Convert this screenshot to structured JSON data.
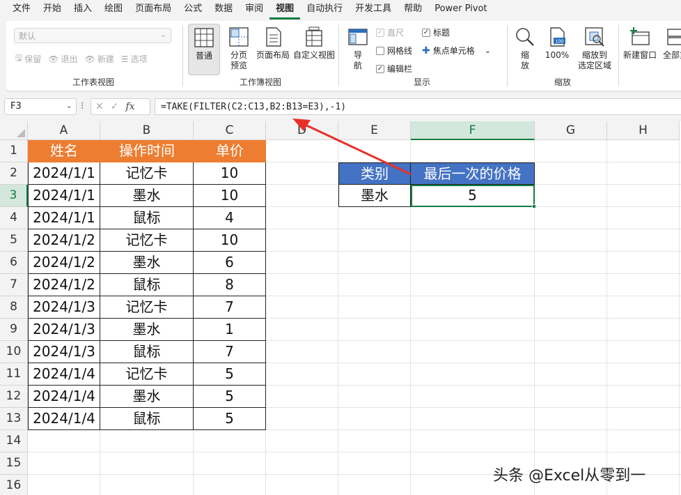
{
  "menu": {
    "tabs": [
      "文件",
      "开始",
      "插入",
      "绘图",
      "页面布局",
      "公式",
      "数据",
      "审阅",
      "视图",
      "自动执行",
      "开发工具",
      "帮助",
      "Power Pivot"
    ],
    "active_index": 8
  },
  "ribbon": {
    "sheet_view": {
      "dropdown_value": "默认",
      "keep": "保留",
      "exit": "退出",
      "new": "新建",
      "options": "选项",
      "group_label": "工作表视图"
    },
    "workbook_views": {
      "normal": "普通",
      "page_break": [
        "分页",
        "预览"
      ],
      "page_layout": "页面布局",
      "custom": "自定义视图",
      "group_label": "工作簿视图"
    },
    "show": {
      "navigation": [
        "导",
        "航"
      ],
      "ruler": "直尺",
      "gridlines": "网格线",
      "formula_bar": "编辑栏",
      "headings": "标题",
      "focus_cell": "焦点单元格",
      "group_label": "显示"
    },
    "zoom": {
      "zoom": [
        "缩",
        "放"
      ],
      "hundred": "100%",
      "hundred_badge": "100",
      "zoom_selection": [
        "缩放到",
        "选定区域"
      ],
      "group_label": "缩放"
    },
    "window": {
      "new_window": "新建窗口",
      "arrange_all": "全部重"
    }
  },
  "formula_bar": {
    "name_box": "F3",
    "formula": "=TAKE(FILTER(C2:C13,B2:B13=E3),-1)",
    "fx": "fx"
  },
  "grid": {
    "columns": [
      "A",
      "B",
      "C",
      "D",
      "E",
      "F",
      "G",
      "H"
    ],
    "rows": [
      "1",
      "2",
      "3",
      "4",
      "5",
      "6",
      "7",
      "8",
      "9",
      "10",
      "11",
      "12",
      "13",
      "14",
      "15",
      "16"
    ],
    "selected_column": "F",
    "selected_row": "3"
  },
  "table": {
    "headers": [
      "姓名",
      "操作时间",
      "单价"
    ],
    "rows": [
      [
        "2024/1/1",
        "记忆卡",
        "10"
      ],
      [
        "2024/1/1",
        "墨水",
        "10"
      ],
      [
        "2024/1/1",
        "鼠标",
        "4"
      ],
      [
        "2024/1/2",
        "记忆卡",
        "10"
      ],
      [
        "2024/1/2",
        "墨水",
        "6"
      ],
      [
        "2024/1/2",
        "鼠标",
        "8"
      ],
      [
        "2024/1/3",
        "记忆卡",
        "7"
      ],
      [
        "2024/1/3",
        "墨水",
        "1"
      ],
      [
        "2024/1/3",
        "鼠标",
        "7"
      ],
      [
        "2024/1/4",
        "记忆卡",
        "5"
      ],
      [
        "2024/1/4",
        "墨水",
        "5"
      ],
      [
        "2024/1/4",
        "鼠标",
        "5"
      ]
    ]
  },
  "lookup": {
    "headers": [
      "类别",
      "最后一次的价格"
    ],
    "category": "墨水",
    "result": "5"
  },
  "watermark": "头条 @Excel从零到一",
  "colors": {
    "header_orange": "#ed7d31",
    "header_blue": "#4472c4",
    "excel_green": "#107c41",
    "arrow_red": "#e8302a"
  }
}
